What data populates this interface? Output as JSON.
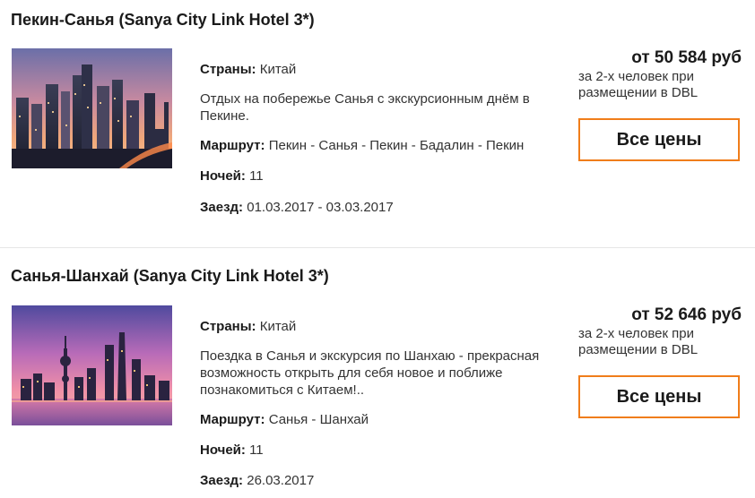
{
  "tours": [
    {
      "title": "Пекин-Санья (Sanya City Link Hotel 3*)",
      "image_icon": "beijing-skyline-photo",
      "countries_label": "Страны:",
      "countries_value": "Китай",
      "description": "Отдых на побережье Санья с экскурсионным днём в Пекине.",
      "route_label": "Маршрут:",
      "route_value": "Пекин - Санья - Пекин - Бадалин - Пекин",
      "nights_label": "Ночей:",
      "nights_value": "11",
      "checkin_label": "Заезд:",
      "checkin_value": "01.03.2017 - 03.03.2017",
      "price": "от 50 584 руб",
      "price_note": "за 2-х человек при размещении в DBL",
      "button_label": "Все цены"
    },
    {
      "title": "Санья-Шанхай (Sanya City Link Hotel 3*)",
      "image_icon": "shanghai-skyline-photo",
      "countries_label": "Страны:",
      "countries_value": "Китай",
      "description": "Поездка в Санья и экскурсия по Шанхаю - прекрасная возможность открыть для себя новое и поближе познакомиться с Китаем!..",
      "route_label": "Маршрут:",
      "route_value": "Санья - Шанхай",
      "nights_label": "Ночей:",
      "nights_value": "11",
      "checkin_label": "Заезд:",
      "checkin_value": "26.03.2017",
      "price": "от 52 646 руб",
      "price_note": "за 2-х человек при размещении в DBL",
      "button_label": "Все цены"
    }
  ],
  "colors": {
    "accent_border": "#f07d1a",
    "divider": "#e6e6e6"
  }
}
